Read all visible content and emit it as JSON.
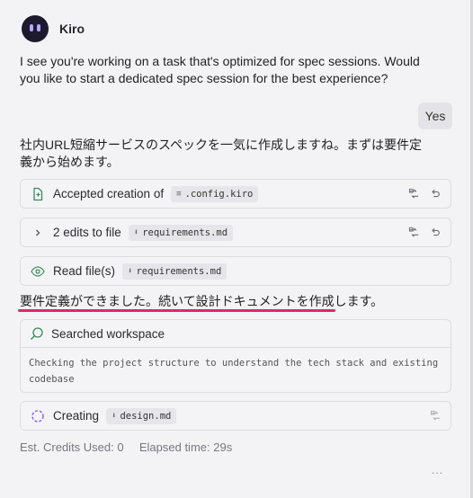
{
  "agent": {
    "name": "Kiro"
  },
  "messages": {
    "prompt": "I see you're working on a task that's optimized for spec sessions. Would you like to start a dedicated spec session for the best experience?",
    "yes_label": "Yes",
    "intro": "社内URL短縮サービスのスペックを一気に作成しますね。まずは要件定義から始めます。",
    "progress_note": "要件定義ができました。続いて設計ドキュメントを作成します。"
  },
  "steps": [
    {
      "label": "Accepted creation of",
      "file": ".config.kiro",
      "icon": "file-plus-icon"
    },
    {
      "label": "2 edits to file",
      "file": "requirements.md",
      "icon": "chevron-right-icon"
    },
    {
      "label": "Read file(s)",
      "file": "requirements.md",
      "icon": "eye-icon"
    }
  ],
  "search": {
    "title": "Searched workspace",
    "detail": "Checking the project structure to understand the tech stack and existing codebase"
  },
  "creating": {
    "label": "Creating",
    "file": "design.md"
  },
  "footer": {
    "credits": "Est. Credits Used: 0",
    "elapsed": "Elapsed time: 29s",
    "more": "..."
  },
  "colors": {
    "accent_underline": "#e5246b",
    "icon_green": "#3a8a5c",
    "spinner": "#8a6cf0"
  }
}
